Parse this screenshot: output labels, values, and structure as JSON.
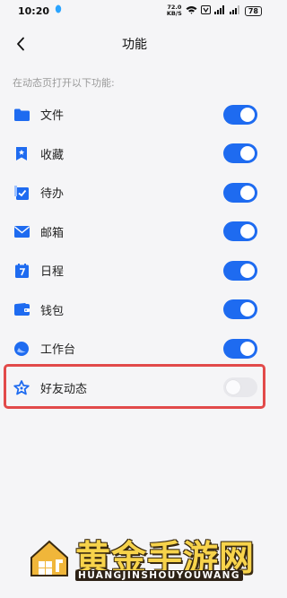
{
  "status": {
    "time": "10:20",
    "speed_value": "72.0",
    "speed_unit": "KB/S",
    "battery": "78"
  },
  "header": {
    "title": "功能"
  },
  "section_hint": "在动态页打开以下功能:",
  "items": [
    {
      "label": "文件",
      "icon": "folder-icon",
      "enabled": true
    },
    {
      "label": "收藏",
      "icon": "bookmark-icon",
      "enabled": true
    },
    {
      "label": "待办",
      "icon": "checkbox-icon",
      "enabled": true
    },
    {
      "label": "邮箱",
      "icon": "mail-icon",
      "enabled": true
    },
    {
      "label": "日程",
      "icon": "calendar-icon",
      "enabled": true
    },
    {
      "label": "钱包",
      "icon": "wallet-icon",
      "enabled": true
    },
    {
      "label": "工作台",
      "icon": "workbench-icon",
      "enabled": true
    },
    {
      "label": "好友动态",
      "icon": "star-outline-icon",
      "enabled": false
    }
  ],
  "watermark": {
    "title": "黄金手游网",
    "subtitle": "HUANGJINSHOUYOUWANG"
  },
  "colors": {
    "accent": "#1e6bf0",
    "highlight": "#e24a4a",
    "toggle_off": "#e8e8ec"
  }
}
